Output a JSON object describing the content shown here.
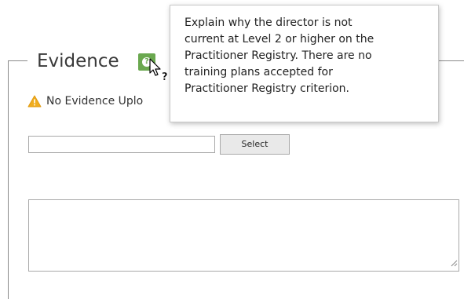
{
  "section": {
    "legend": "Evidence",
    "help_icon": "help-icon",
    "warning_icon": "warning-triangle-icon",
    "warning_text": "No Evidence Uplo",
    "select_button_label": "Select",
    "file_path_value": "",
    "comment_value": ""
  },
  "tooltip": {
    "lines": [
      "Explain why the director is not",
      "current at Level 2 or higher on the",
      "Practitioner Registry. There are no",
      "training plans accepted for",
      "Practitioner Registry criterion."
    ]
  },
  "colors": {
    "help_icon": "#6aa84f",
    "warning_icon": "#f0ad1e"
  }
}
